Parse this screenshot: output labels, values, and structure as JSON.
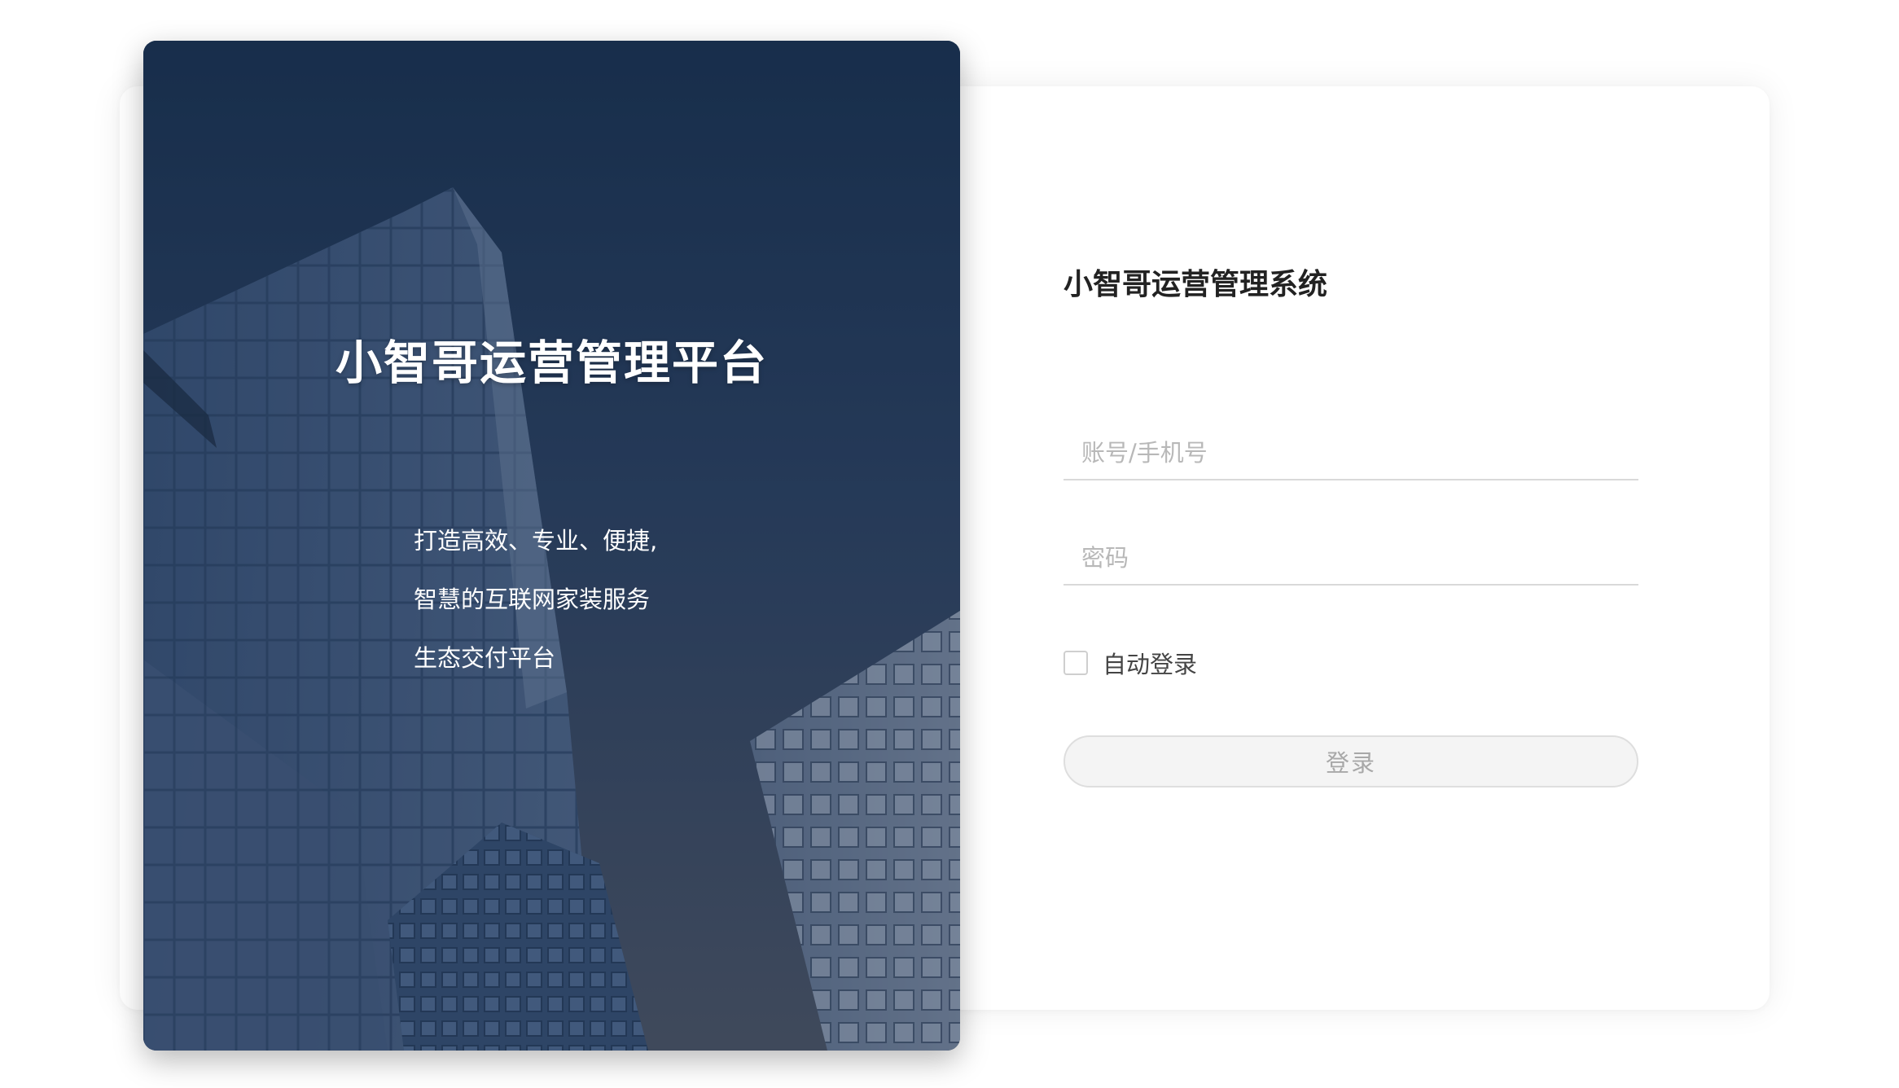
{
  "hero": {
    "title": "小智哥运营管理平台",
    "lines": [
      "打造高效、专业、便捷,",
      "智慧的互联网家装服务",
      "生态交付平台"
    ]
  },
  "form": {
    "title": "小智哥运营管理系统",
    "account_placeholder": "账号/手机号",
    "password_placeholder": "密码",
    "remember_label": "自动登录",
    "remember_checked": false,
    "login_label": "登录"
  },
  "colors": {
    "hero_overlay": "#1a2f4e",
    "button_bg": "#f4f4f4",
    "button_text": "#a8a8a8",
    "title_text": "#222222"
  }
}
